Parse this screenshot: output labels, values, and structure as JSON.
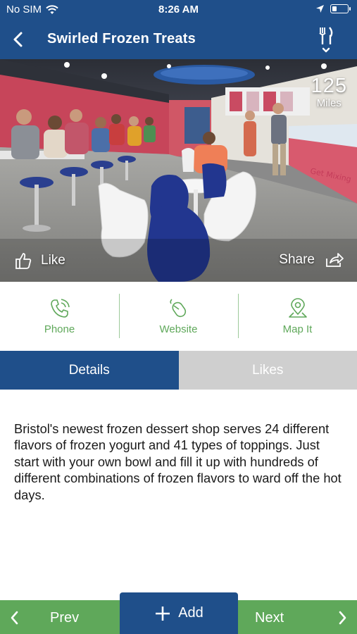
{
  "status_bar": {
    "carrier": "No SIM",
    "time": "8:26 AM"
  },
  "header": {
    "title": "Swirled Frozen Treats",
    "back_icon": "chevron-left-icon",
    "category_icon": "fork-knife-icon"
  },
  "hero": {
    "distance_value": "125",
    "distance_unit": "Miles",
    "like_label": "Like",
    "share_label": "Share"
  },
  "actions": [
    {
      "label": "Phone",
      "icon": "phone-icon"
    },
    {
      "label": "Website",
      "icon": "mouse-icon"
    },
    {
      "label": "Map It",
      "icon": "map-pin-icon"
    }
  ],
  "tabs": [
    {
      "label": "Details",
      "active": true
    },
    {
      "label": "Likes",
      "active": false
    }
  ],
  "description": "Bristol's newest frozen dessert shop serves 24 different flavors of frozen yogurt and 41 types of toppings. Just start with your own bowl and fill it up with hundreds of different combinations of frozen flavors to ward off the hot days.",
  "bottom_nav": {
    "prev_label": "Prev",
    "add_label": "Add",
    "next_label": "Next"
  },
  "colors": {
    "primary_blue": "#1f4f8a",
    "accent_green": "#5fa85a",
    "inactive_tab": "#cfcfcf"
  }
}
